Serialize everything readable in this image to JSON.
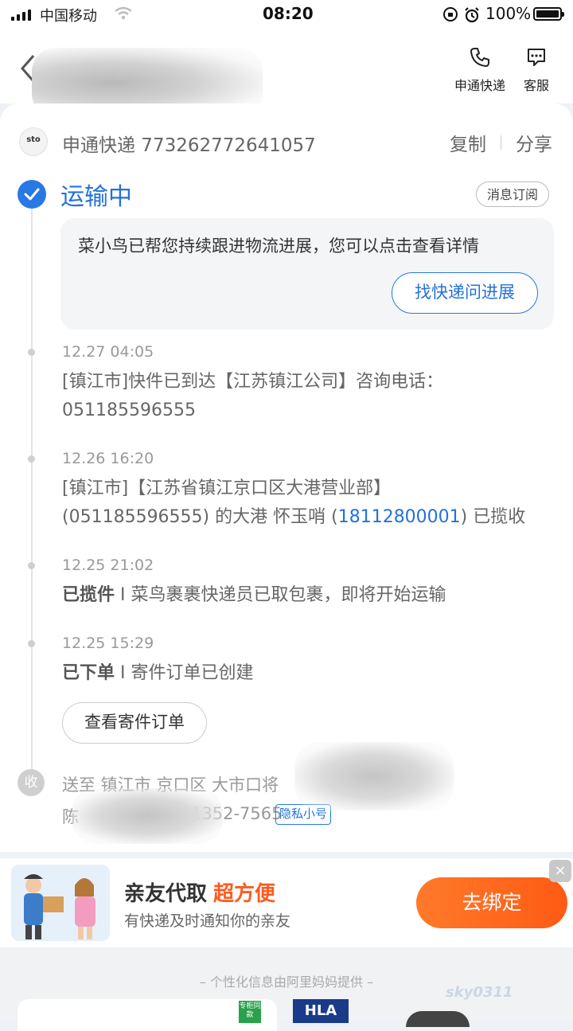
{
  "status_bar": {
    "carrier": "中国移动",
    "time": "08:20",
    "battery": "100%"
  },
  "nav": {
    "carrier_button": "申通快递",
    "service_button": "客服"
  },
  "shipment": {
    "logo_text": "sto",
    "tracking_line": "申通快递 773262772641057",
    "copy_label": "复制",
    "share_label": "分享",
    "status": "运输中",
    "subscribe_label": "消息订阅"
  },
  "notice": {
    "text": "菜小鸟已帮您持续跟进物流进展，您可以点击查看详情",
    "button": "找快递问进展"
  },
  "events": [
    {
      "time": "12.27 04:05",
      "line1": "[镇江市]快件已到达【江苏镇江公司】咨询电话：",
      "line2": "051185596555"
    },
    {
      "time": "12.26 16:20",
      "line1": "[镇江市]【江苏省镇江京口区大港营业部】",
      "line2_prefix": "(051185596555) 的大港  怀玉哨 (",
      "line2_link": "18112800001",
      "line2_suffix": ") 已揽收"
    },
    {
      "time": "12.25 21:02",
      "bold": "已揽件",
      "rest": " I 菜鸟裹裹快递员已取包裹，即将开始运输"
    },
    {
      "time": "12.25 15:29",
      "bold": "已下单",
      "rest": " I 寄件订单已创建"
    }
  ],
  "view_order_button": "查看寄件订单",
  "receiver": {
    "badge": "收",
    "address": "送至  镇江市 京口区 大市口将",
    "contact": "陈",
    "phone_tail": "1352-7565",
    "private_tag": "隐私小号"
  },
  "banner": {
    "title": "亲友代取",
    "highlight": "超方便",
    "subtitle": "有快递及时通知你的亲友",
    "button": "去绑定",
    "close": "×"
  },
  "footer": {
    "note": "– 个性化信息由阿里妈妈提供 –",
    "ad_tag": "专柜同款",
    "ad_brand": "HLA",
    "watermark": "sky0311"
  }
}
